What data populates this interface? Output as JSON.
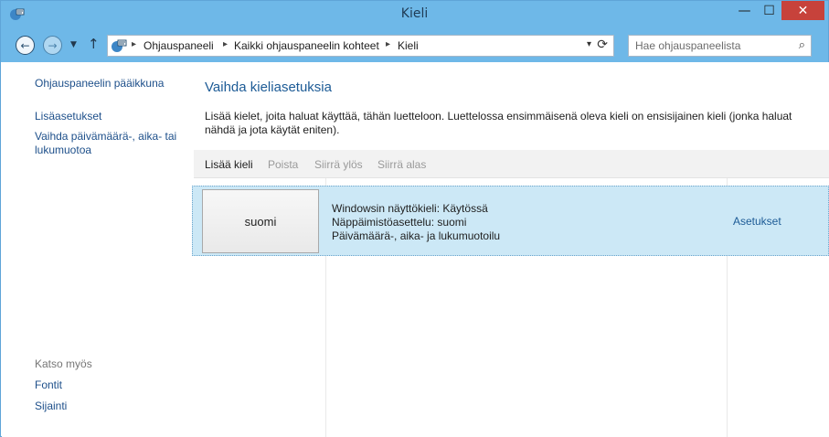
{
  "window": {
    "title": "Kieli"
  },
  "controls": {
    "minimize": "—",
    "maximize": "☐",
    "close": "✕"
  },
  "nav": {
    "back": "←",
    "forward": "→",
    "recent": "▼",
    "up": "↑",
    "breadcrumbs": [
      "Ohjauspaneeli",
      "Kaikki ohjauspaneelin kohteet",
      "Kieli"
    ],
    "separator": "▸",
    "dropdown": "▾",
    "refresh": "⟳"
  },
  "search": {
    "placeholder": "Hae ohjauspaneelista",
    "icon": "⌕"
  },
  "sidebar": {
    "links": [
      "Ohjauspaneelin pääikkuna",
      "Lisäasetukset",
      "Vaihda päivämäärä-, aika- tai lukumuotoa"
    ],
    "see_also_label": "Katso myös",
    "see_also": [
      "Fontit",
      "Sijainti"
    ]
  },
  "main": {
    "heading": "Vaihda kieliasetuksia",
    "description": "Lisää kielet, joita haluat käyttää, tähän luetteloon. Luettelossa ensimmäisenä oleva kieli on ensisijainen kieli (jonka haluat nähdä ja jota käytät eniten).",
    "toolbar": [
      "Lisää kieli",
      "Poista",
      "Siirrä ylös",
      "Siirrä alas"
    ],
    "languages": [
      {
        "name": "suomi",
        "details": [
          "Windowsin näyttökieli: Käytössä",
          "Näppäimistöasettelu: suomi",
          "Päivämäärä-, aika- ja lukumuotoilu"
        ],
        "settings_link": "Asetukset"
      }
    ]
  },
  "colors": {
    "titlebar": "#6eb8e8",
    "link": "#1d4f8a",
    "selection": "#cce8f6",
    "close": "#c7423b"
  }
}
